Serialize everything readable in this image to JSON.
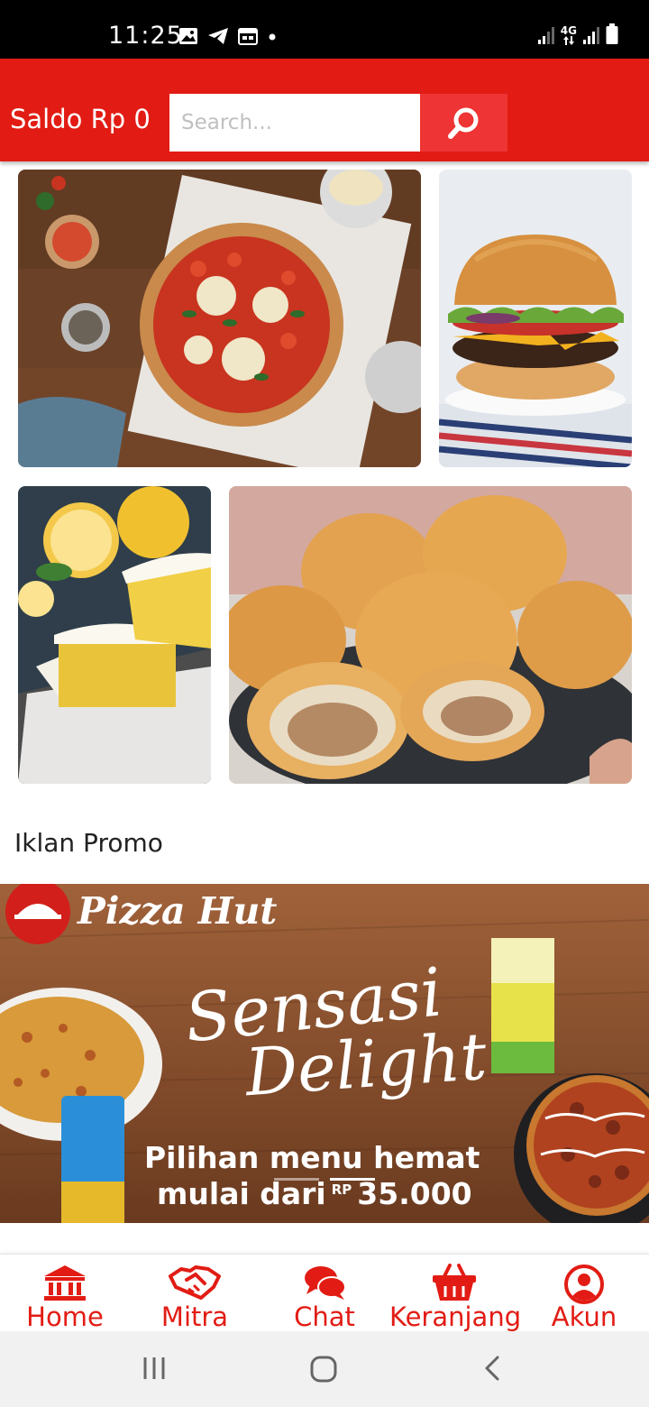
{
  "status_bar": {
    "time": "11:25",
    "network": "4G",
    "left_icons": [
      "image-icon",
      "telegram-icon",
      "calendar-icon",
      "dot-icon"
    ],
    "right_icons": [
      "signal-icon",
      "signal-4g-icon",
      "battery-icon"
    ]
  },
  "header": {
    "saldo": "Saldo Rp 0",
    "search_placeholder": "Search...",
    "search_icon": "search-icon",
    "color": "#e21c14"
  },
  "tiles": [
    {
      "name": "pizza",
      "icon": "pizza-image"
    },
    {
      "name": "burger",
      "icon": "burger-image"
    },
    {
      "name": "lemon-cake",
      "icon": "cake-image"
    },
    {
      "name": "bakpao",
      "icon": "bun-image"
    }
  ],
  "promo": {
    "section_title": "Iklan Promo",
    "brand": "Pizza Hut",
    "headline_1": "Sensasi",
    "headline_2": "Delight",
    "offer_line_1": "Pilihan menu hemat",
    "offer_line_2": "mulai dari",
    "currency": "RP",
    "price": "35.000",
    "carousel_count": 2,
    "carousel_active": 1
  },
  "bottom_nav": {
    "items": [
      {
        "label": "Home",
        "icon": "bank-icon"
      },
      {
        "label": "Mitra",
        "icon": "handshake-icon"
      },
      {
        "label": "Chat",
        "icon": "chat-icon"
      },
      {
        "label": "Keranjang",
        "icon": "basket-icon"
      },
      {
        "label": "Akun",
        "icon": "account-icon"
      }
    ],
    "color": "#e21c14"
  },
  "system_nav": [
    "recent-apps-icon",
    "home-circle-icon",
    "back-icon"
  ]
}
